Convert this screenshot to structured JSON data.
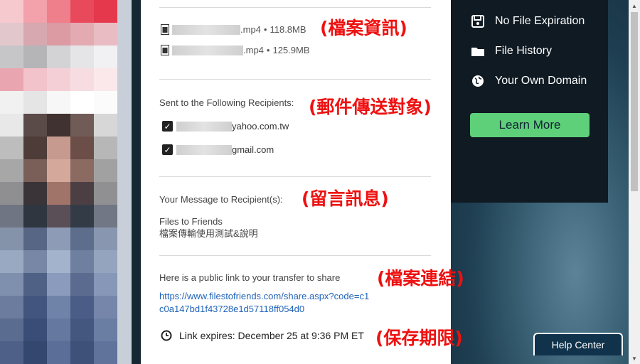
{
  "files": [
    {
      "suffix": ".mp4",
      "size": "118.8MB"
    },
    {
      "suffix": ".mp4",
      "size": "125.9MB"
    }
  ],
  "recipients": {
    "label": "Sent to the Following Recipients:",
    "items": [
      {
        "domain": "yahoo.com.tw",
        "checked": true
      },
      {
        "domain": "gmail.com",
        "checked": true
      }
    ]
  },
  "message": {
    "label": "Your Message to Recipient(s):",
    "title": "Files to Friends",
    "body": "檔案傳輸使用測試&說明"
  },
  "share": {
    "label": "Here is a public link to your transfer to share",
    "url": "https://www.filestofriends.com/share.aspx?code=c1c0a147bd1f43728e1d57118ff054d0"
  },
  "expires": "Link expires: December 25 at 9:36 PM ET",
  "annotations": {
    "files": "(檔案資訊)",
    "recipients": "(郵件傳送對象)",
    "message": "(留言訊息)",
    "link": "(檔案連結)",
    "expires": "(保存期限)"
  },
  "promo": {
    "items": [
      {
        "label": "No File Expiration",
        "icon": "save-icon"
      },
      {
        "label": "File History",
        "icon": "folder-icon"
      },
      {
        "label": "Your Own Domain",
        "icon": "globe-icon"
      }
    ],
    "button": "Learn More",
    "accent": "#5fd07a"
  },
  "help": "Help Center",
  "size_separator": "•"
}
